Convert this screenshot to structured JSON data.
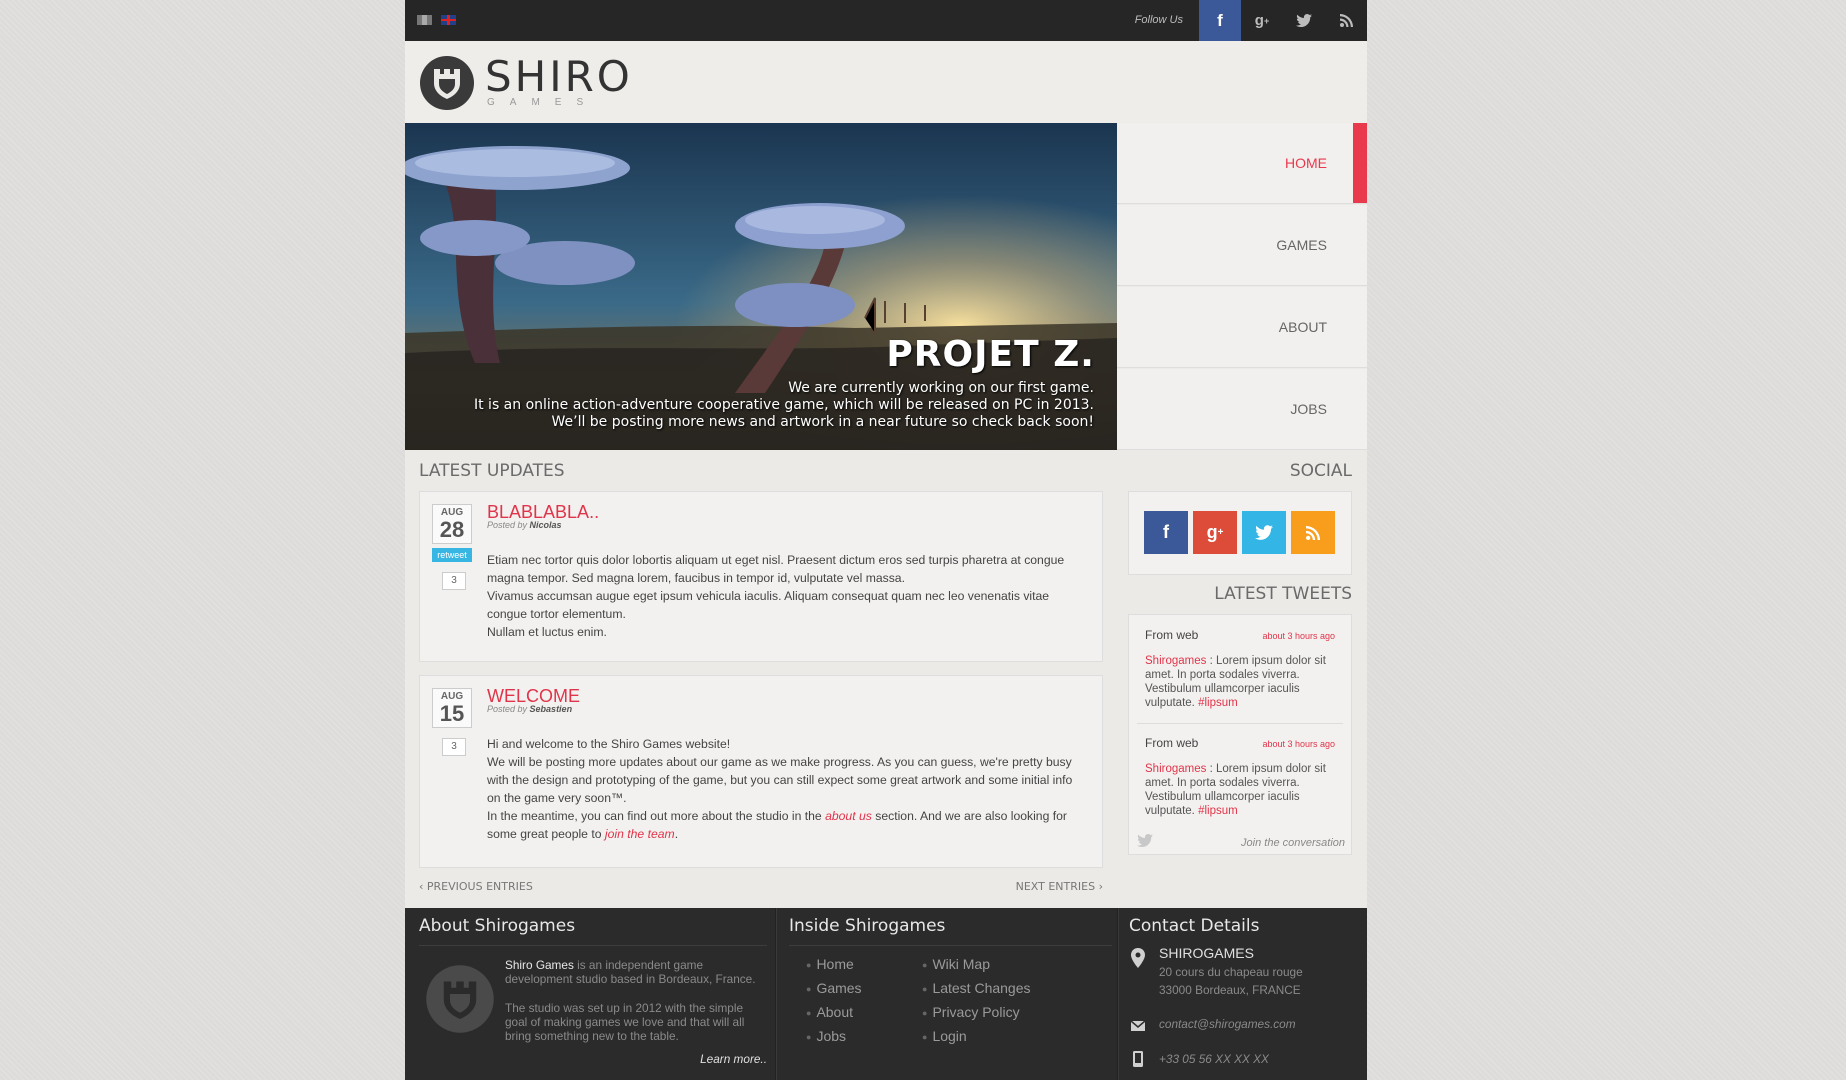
{
  "topbar": {
    "follow_label": "Follow Us",
    "social_icons": [
      "facebook-icon",
      "google-plus-icon",
      "twitter-icon",
      "rss-icon"
    ],
    "languages": [
      "fr-flag",
      "en-flag"
    ]
  },
  "logo": {
    "name": "SHIRO",
    "sub": "GAMES"
  },
  "hero": {
    "title": "PROJET Z.",
    "lines": [
      "We are currently working on our first game.",
      "It is an online action-adventure cooperative game, which will be released on PC in 2013.",
      "We’ll be posting more news and artwork in a near future so check back soon!"
    ]
  },
  "nav": {
    "items": [
      "HOME",
      "GAMES",
      "ABOUT",
      "JOBS"
    ],
    "active": "HOME"
  },
  "latest_updates": {
    "title": "LATEST UPDATES",
    "posts": [
      {
        "month": "AUG",
        "day": "28",
        "retweet": "retweet",
        "comments": "3",
        "title": "BLABLABLA..",
        "posted_by": "Posted by",
        "author": "Nicolas",
        "paragraphs": [
          "Etiam nec tortor quis dolor lobortis aliquam ut eget nisl. Praesent dictum eros sed turpis pharetra at congue magna tempor. Sed magna lorem, faucibus in tempor id, vulputate vel massa.",
          "Vivamus accumsan augue eget ipsum vehicula iaculis. Aliquam consequat quam nec leo venenatis vitae congue tortor elementum.",
          "Nullam et luctus enim."
        ]
      },
      {
        "month": "AUG",
        "day": "15",
        "comments": "3",
        "title": "WELCOME",
        "posted_by": "Posted by",
        "author": "Sebastien",
        "p1": "Hi and welcome to the Shiro Games website!",
        "p2": "We will be posting more updates about our game as we make progress. As you can guess, we're pretty busy with the design and prototyping of the game, but you can still expect some great artwork and some initial info on the game very soon™.",
        "p3_a": "In the meantime, you can find out more about the studio in the",
        "p3_link": "about us",
        "p3_b": "section. And we are also looking for some great people to",
        "p3_link2": "join the team",
        "p3_c": "."
      }
    ],
    "prev": "PREVIOUS ENTRIES",
    "next": "NEXT ENTRIES"
  },
  "sidebar": {
    "social_title": "SOCIAL",
    "social_buttons": [
      {
        "icon": "facebook-icon",
        "color": "#3b5998"
      },
      {
        "icon": "google-plus-icon",
        "color": "#dd4b39"
      },
      {
        "icon": "twitter-icon",
        "color": "#33b5e5"
      },
      {
        "icon": "rss-icon",
        "color": "#f99d1c"
      }
    ],
    "tweets_title": "LATEST TWEETS",
    "tweets": [
      {
        "from": "From web",
        "time": "about 3 hours ago",
        "user": "Shirogames",
        "text": " : Lorem ipsum dolor sit amet. In porta sodales viverra. Vestibulum ullamcorper iaculis vulputate.",
        "hashtag": "#lipsum"
      },
      {
        "from": "From web",
        "time": "about 3 hours ago",
        "user": "Shirogames",
        "text": " : Lorem ipsum dolor sit amet. In porta sodales viverra. Vestibulum ullamcorper iaculis vulputate.",
        "hashtag": "#lipsum"
      }
    ],
    "join": "Join the conversation"
  },
  "footer": {
    "about": {
      "title": "About Shirogames",
      "name": "Shiro Games",
      "text1": " is an independent game development studio based in Bordeaux, France.",
      "text2": "The studio was set up in 2012 with the simple goal of making games we love and that will all bring something new to the table.",
      "learn_more": "Learn more.."
    },
    "inside": {
      "title": "Inside Shirogames",
      "col1": [
        "Home",
        "Games",
        "About",
        "Jobs"
      ],
      "col2": [
        "Wiki Map",
        "Latest Changes",
        "Privacy Policy",
        "Login"
      ]
    },
    "contact": {
      "title": "Contact Details",
      "company": "SHIROGAMES",
      "address1": "20 cours du chapeau rouge",
      "address2": "33000 Bordeaux, FRANCE",
      "email": "contact@shirogames.com",
      "phone": "+33 05 56 XX XX XX"
    }
  },
  "colors": {
    "accent": "#e8394d",
    "topbar": "#262626",
    "footer": "#2b2b2b",
    "facebook": "#3b5998"
  }
}
